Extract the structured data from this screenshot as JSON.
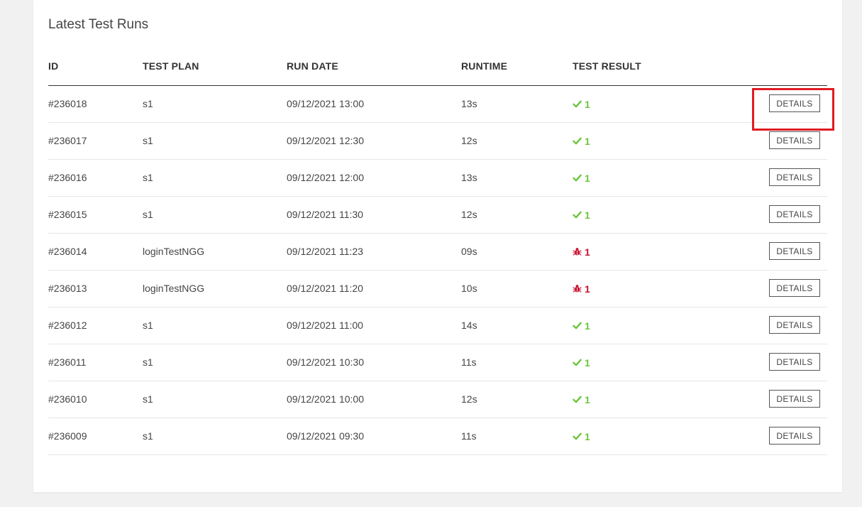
{
  "panel": {
    "title": "Latest Test Runs"
  },
  "table": {
    "columns": {
      "id": "ID",
      "test_plan": "TEST PLAN",
      "run_date": "RUN DATE",
      "runtime": "RUNTIME",
      "test_result": "TEST RESULT"
    },
    "rows": [
      {
        "id": "#236018",
        "test_plan": "s1",
        "run_date": "09/12/2021 13:00",
        "runtime": "13s",
        "result_status": "pass",
        "result_icon": "check-icon",
        "result_count": "1",
        "action_label": "DETAILS"
      },
      {
        "id": "#236017",
        "test_plan": "s1",
        "run_date": "09/12/2021 12:30",
        "runtime": "12s",
        "result_status": "pass",
        "result_icon": "check-icon",
        "result_count": "1",
        "action_label": "DETAILS"
      },
      {
        "id": "#236016",
        "test_plan": "s1",
        "run_date": "09/12/2021 12:00",
        "runtime": "13s",
        "result_status": "pass",
        "result_icon": "check-icon",
        "result_count": "1",
        "action_label": "DETAILS"
      },
      {
        "id": "#236015",
        "test_plan": "s1",
        "run_date": "09/12/2021 11:30",
        "runtime": "12s",
        "result_status": "pass",
        "result_icon": "check-icon",
        "result_count": "1",
        "action_label": "DETAILS"
      },
      {
        "id": "#236014",
        "test_plan": "loginTestNGG",
        "run_date": "09/12/2021 11:23",
        "runtime": "09s",
        "result_status": "fail",
        "result_icon": "bug-icon",
        "result_count": "1",
        "action_label": "DETAILS"
      },
      {
        "id": "#236013",
        "test_plan": "loginTestNGG",
        "run_date": "09/12/2021 11:20",
        "runtime": "10s",
        "result_status": "fail",
        "result_icon": "bug-icon",
        "result_count": "1",
        "action_label": "DETAILS"
      },
      {
        "id": "#236012",
        "test_plan": "s1",
        "run_date": "09/12/2021 11:00",
        "runtime": "14s",
        "result_status": "pass",
        "result_icon": "check-icon",
        "result_count": "1",
        "action_label": "DETAILS"
      },
      {
        "id": "#236011",
        "test_plan": "s1",
        "run_date": "09/12/2021 10:30",
        "runtime": "11s",
        "result_status": "pass",
        "result_icon": "check-icon",
        "result_count": "1",
        "action_label": "DETAILS"
      },
      {
        "id": "#236010",
        "test_plan": "s1",
        "run_date": "09/12/2021 10:00",
        "runtime": "12s",
        "result_status": "pass",
        "result_icon": "check-icon",
        "result_count": "1",
        "action_label": "DETAILS"
      },
      {
        "id": "#236009",
        "test_plan": "s1",
        "run_date": "09/12/2021 09:30",
        "runtime": "11s",
        "result_status": "pass",
        "result_icon": "check-icon",
        "result_count": "1",
        "action_label": "DETAILS"
      }
    ]
  },
  "colors": {
    "pass": "#6cc53c",
    "fail": "#c8102e",
    "highlight": "#e01b22",
    "background": "#f1f1f1"
  }
}
